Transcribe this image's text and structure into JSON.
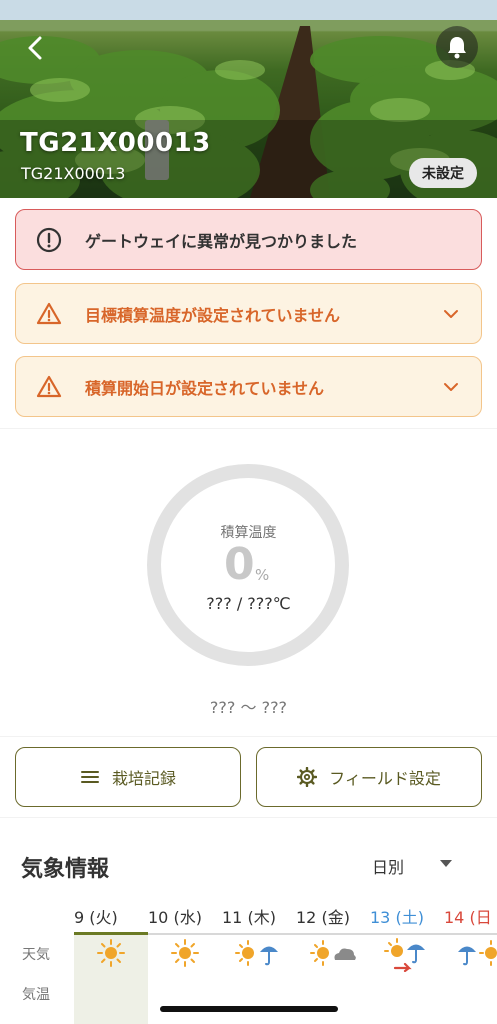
{
  "header": {
    "title": "TG21X00013",
    "subtitle": "TG21X00013",
    "badge": "未設定"
  },
  "alerts": [
    {
      "type": "error",
      "text": "ゲートウェイに異常が見つかりました",
      "icon": "error-circle-icon"
    },
    {
      "type": "warning",
      "text": "目標積算温度が設定されていません",
      "icon": "warning-triangle-icon"
    },
    {
      "type": "warning",
      "text": "積算開始日が設定されていません",
      "icon": "warning-triangle-icon"
    }
  ],
  "gauge": {
    "label": "積算温度",
    "percent": "0",
    "unit": "%",
    "progress": 0,
    "range": "??? / ???℃",
    "dates": "??? 〜 ???"
  },
  "buttons": {
    "record": "栽培記録",
    "field_settings": "フィールド設定"
  },
  "weather": {
    "title": "気象情報",
    "period": "日別",
    "days": [
      "9 (火)",
      "10 (水)",
      "11 (木)",
      "12 (金)",
      "13 (土)",
      "14 (日"
    ],
    "row_weather": "天気",
    "row_temp": "気温",
    "icons": [
      "sun-icon",
      "sun-icon",
      "sun-umbrella-icon",
      "sun-cloud-icon",
      "sun-umbrella-icon",
      "umbrella-sun-icon"
    ]
  },
  "colors": {
    "error_border": "#d85b5b",
    "warning_text": "#d8662a",
    "button_border": "#6b6a2c",
    "saturday": "#3f8fd6",
    "sunday": "#d9483b"
  }
}
